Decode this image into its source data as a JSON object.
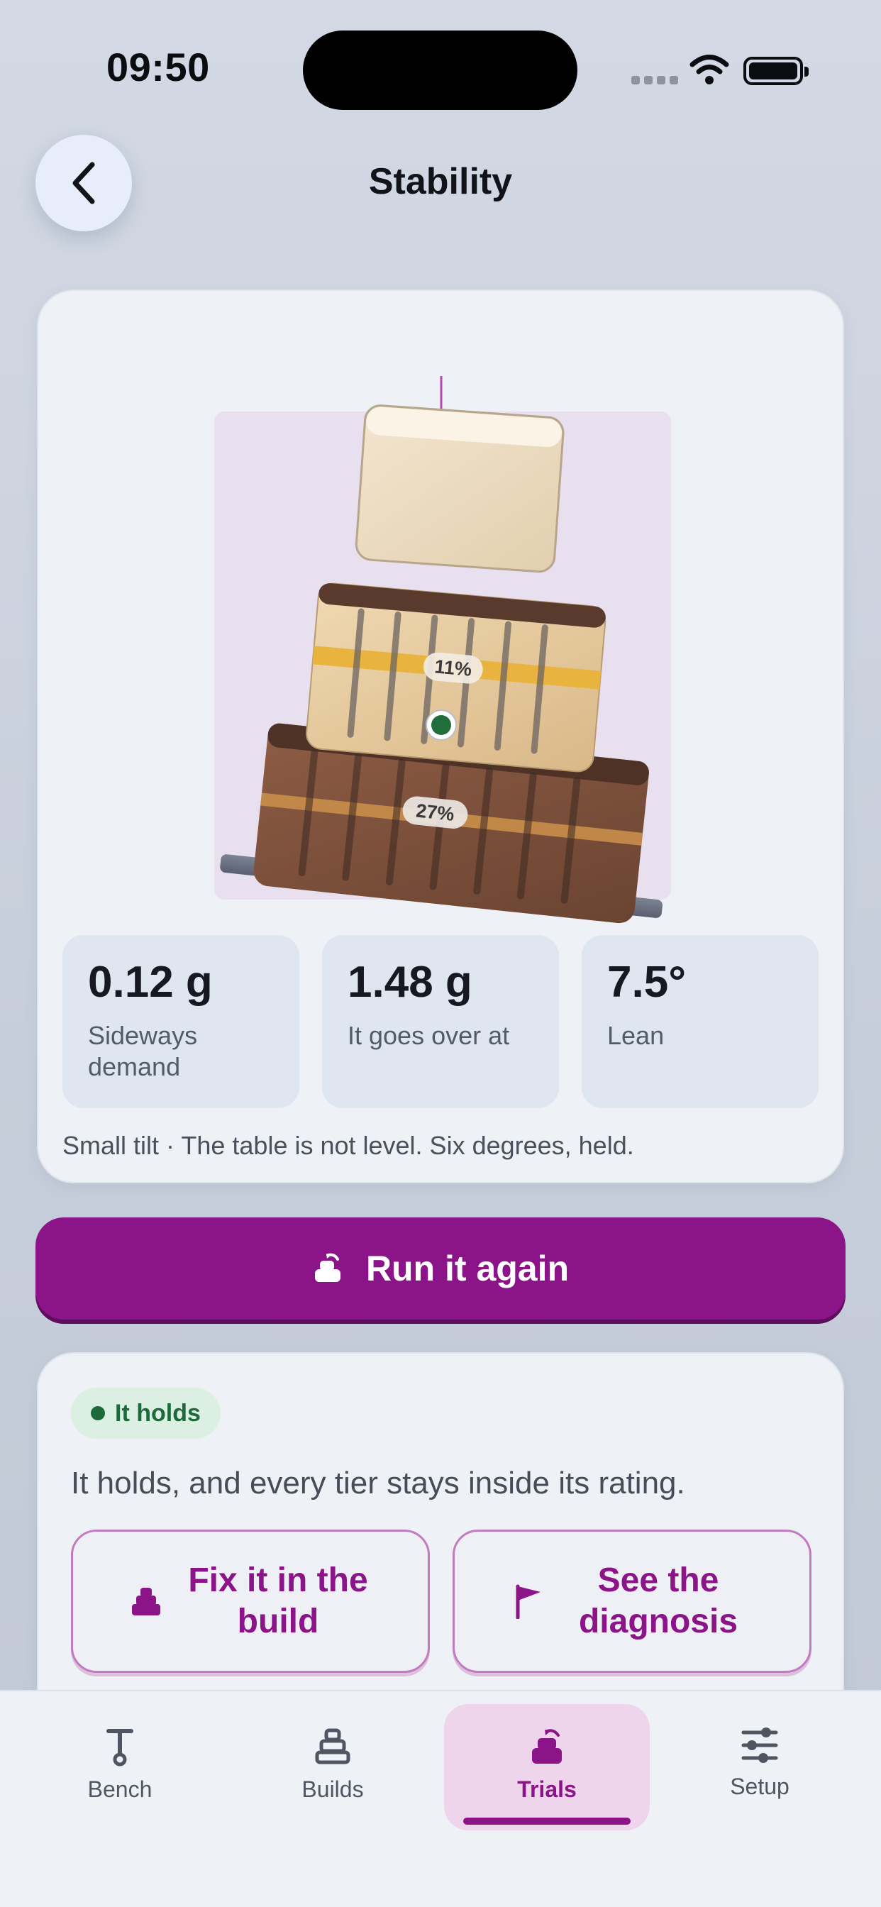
{
  "status_bar": {
    "time": "09:50"
  },
  "header": {
    "title": "Stability"
  },
  "figure": {
    "tier_labels": {
      "middle": "11%",
      "bottom": "27%"
    }
  },
  "stats": [
    {
      "value": "0.12 g",
      "label": "Sideways demand"
    },
    {
      "value": "1.48 g",
      "label": "It goes over at"
    },
    {
      "value": "7.5°",
      "label": "Lean"
    }
  ],
  "caption": "Small tilt · The table is not level. Six degrees, held.",
  "run_button": {
    "label": "Run it again"
  },
  "result": {
    "badge": "It holds",
    "text": "It holds, and every tier stays inside its rating.",
    "fix_button": "Fix it in the build",
    "diagnosis_button": "See the diagnosis"
  },
  "tab_bar": {
    "tabs": [
      {
        "label": "Bench",
        "icon": "pin-tool-icon"
      },
      {
        "label": "Builds",
        "icon": "stack-icon"
      },
      {
        "label": "Trials",
        "icon": "cake-tilt-icon",
        "active": true
      },
      {
        "label": "Setup",
        "icon": "sliders-icon"
      }
    ]
  },
  "colors": {
    "accent": "#8a1488",
    "holds_green": "#1b6b3a",
    "status_dot": "#1f6e3b"
  }
}
